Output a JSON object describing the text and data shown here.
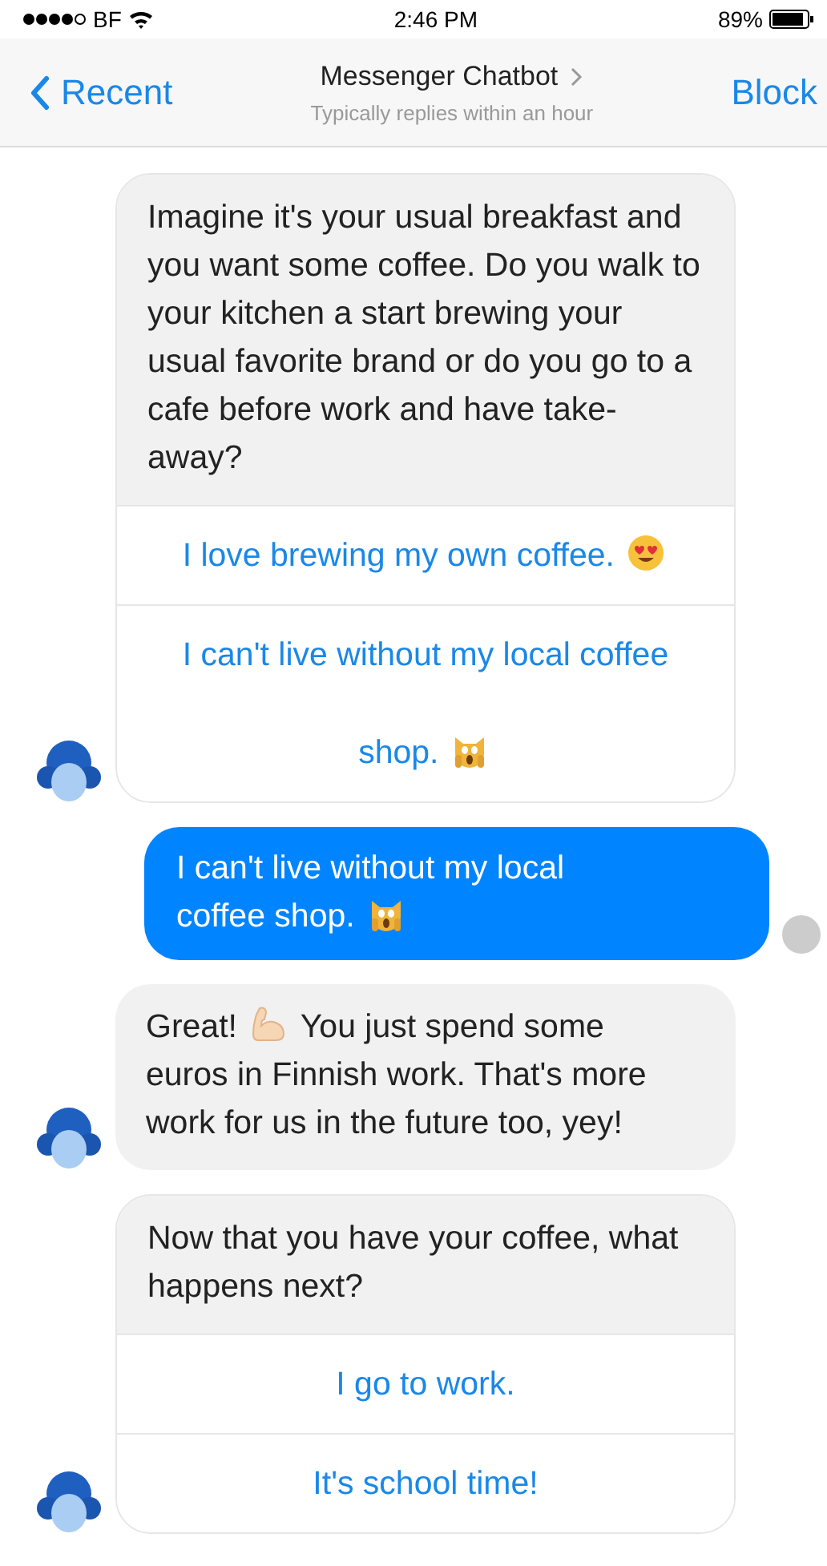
{
  "status_bar": {
    "carrier": "BF",
    "time": "2:46 PM",
    "battery": "89%"
  },
  "header": {
    "back_label": "Recent",
    "title": "Messenger Chatbot",
    "subtitle": "Typically replies within an hour",
    "action": "Block"
  },
  "messages": [
    {
      "kind": "card",
      "avatar": true,
      "text": "Imagine it's your usual breakfast and you want some coffee. Do you walk to your kitchen a start brewing your usual favorite brand or do you go to a cafe before work and have take-away?",
      "options": [
        {
          "parts": [
            {
              "kind": "text",
              "text": "I love brewing my own coffee."
            },
            {
              "kind": "heart-eyes"
            }
          ]
        },
        {
          "parts": [
            {
              "kind": "text",
              "text": "I can't live without my local coffee shop."
            },
            {
              "kind": "screaming-cat"
            }
          ]
        }
      ]
    },
    {
      "kind": "user",
      "delivered": true,
      "parts": [
        {
          "kind": "text",
          "text": "I can't live without my local"
        },
        {
          "kind": "text",
          "text": "coffee shop."
        },
        {
          "kind": "screaming-cat"
        }
      ]
    },
    {
      "kind": "bot",
      "avatar": true,
      "parts": [
        {
          "kind": "text",
          "text": "Great!"
        },
        {
          "kind": "muscle"
        },
        {
          "kind": "text",
          "text": "You just spend some"
        },
        {
          "kind": "text",
          "text": "euros in Finnish work. That's more work for us in the future too, yey!"
        }
      ]
    },
    {
      "kind": "card",
      "avatar": true,
      "text": "Now that you have your coffee, what happens next?",
      "options": [
        {
          "parts": [
            {
              "kind": "text",
              "text": "I go to work."
            }
          ]
        },
        {
          "parts": [
            {
              "kind": "text",
              "text": "It's school time!"
            }
          ]
        }
      ]
    }
  ]
}
